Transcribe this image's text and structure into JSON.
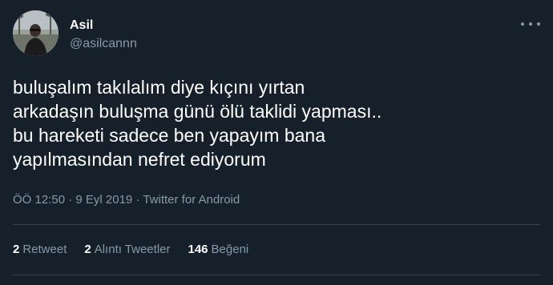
{
  "author": {
    "name": "Asil",
    "handle": "@asilcannn"
  },
  "menu": {
    "icon": "more-horizontal-icon"
  },
  "tweet": {
    "lines": [
      "buluşalım takılalım diye kıçını yırtan",
      "arkadaşın buluşma günü ölü taklidi yapması..",
      "bu hareketi sadece ben yapayım bana",
      "yapılmasından nefret ediyorum"
    ]
  },
  "meta": {
    "time": "ÖÖ 12:50",
    "date": "9 Eyl 2019",
    "source": "Twitter for Android",
    "separator": " · "
  },
  "stats": {
    "retweets": {
      "count": "2",
      "label": "Retweet"
    },
    "quotes": {
      "count": "2",
      "label": "Alıntı Tweetler"
    },
    "likes": {
      "count": "146",
      "label": "Beğeni"
    }
  },
  "colors": {
    "background": "#15202b",
    "text": "#ffffff",
    "secondary": "#8899a6",
    "divider": "#38444d"
  }
}
